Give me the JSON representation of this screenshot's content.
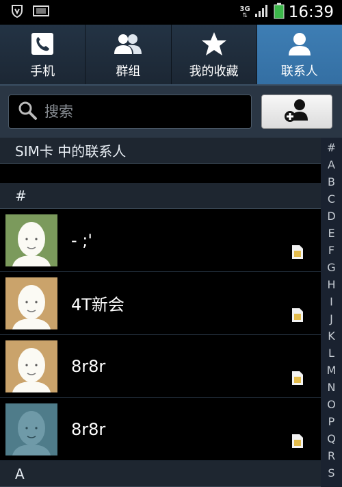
{
  "status_bar": {
    "network_label": "3G",
    "clock": "16:39",
    "icons": [
      "shield-icon",
      "sim-card-indicator-icon",
      "signal-icon",
      "battery-icon"
    ],
    "battery_color": "#3cb84a"
  },
  "tabs": [
    {
      "label": "手机",
      "icon": "phone-icon",
      "active": false
    },
    {
      "label": "群组",
      "icon": "group-icon",
      "active": false
    },
    {
      "label": "我的收藏",
      "icon": "star-icon",
      "active": false
    },
    {
      "label": "联系人",
      "icon": "person-icon",
      "active": true
    }
  ],
  "search": {
    "placeholder": "搜索",
    "value": ""
  },
  "list": {
    "section_sim": "SIM卡 中的联系人",
    "section_hash": "#",
    "section_a": "A",
    "contacts": [
      {
        "name": "- ;'",
        "avatar_color": "#7b9a5c"
      },
      {
        "name": "4T新会",
        "avatar_color": "#caa36b"
      },
      {
        "name": "8r8r",
        "avatar_color": "#caa36b"
      },
      {
        "name": "8r8r",
        "avatar_color": "#4f7c8a"
      }
    ]
  },
  "index_bar": [
    "#",
    "A",
    "B",
    "C",
    "D",
    "E",
    "F",
    "G",
    "H",
    "I",
    "J",
    "K",
    "L",
    "M",
    "N",
    "O",
    "P",
    "Q",
    "R",
    "S"
  ],
  "colors": {
    "accent": "#3e7eb4",
    "tab_bg": "#233344"
  }
}
